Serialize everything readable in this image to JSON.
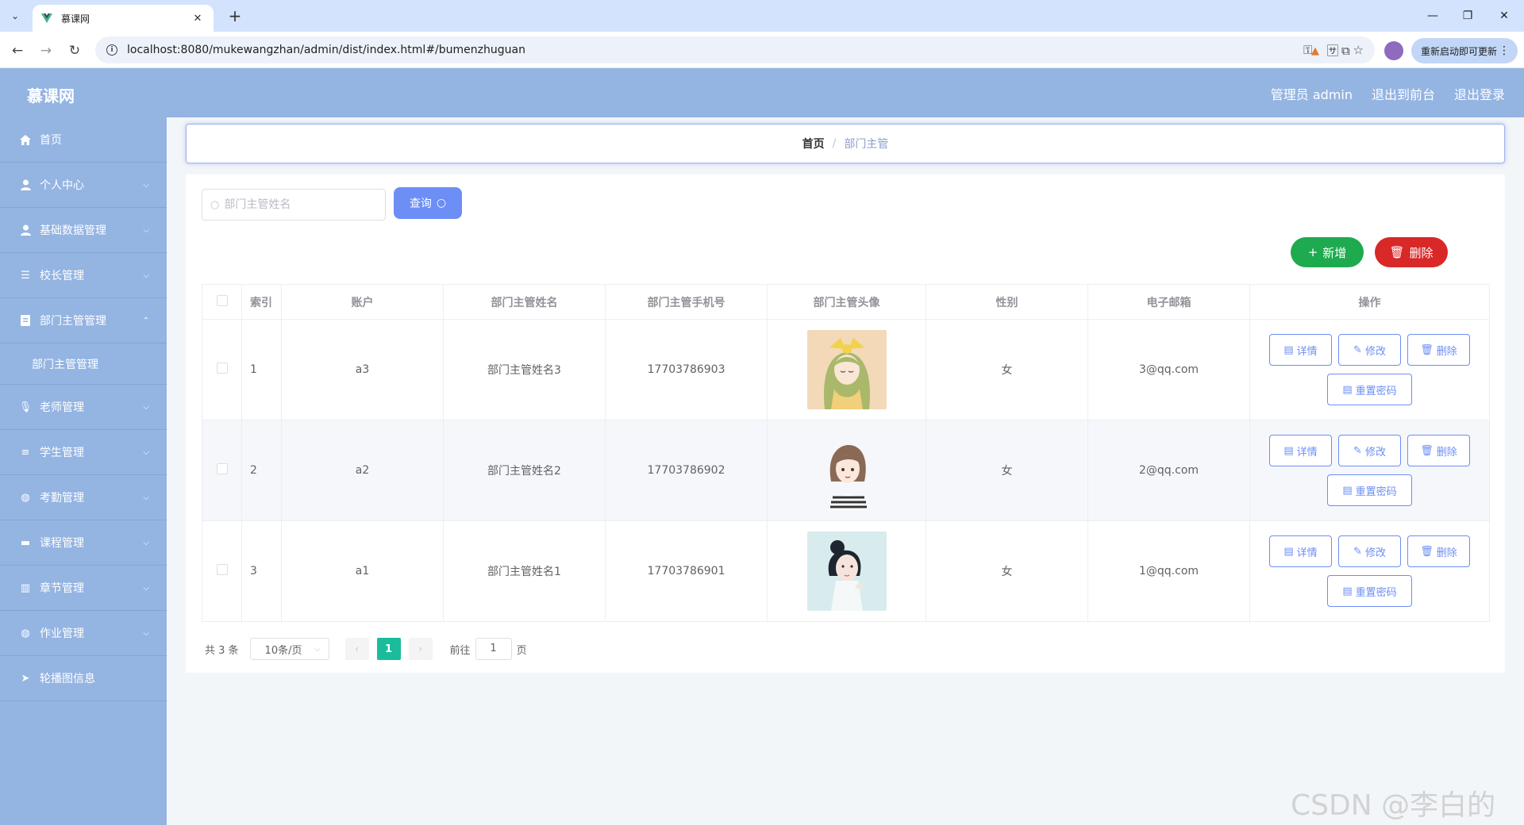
{
  "browser": {
    "tab_title": "慕课网",
    "url": "localhost:8080/mukewangzhan/admin/dist/index.html#/bumenzhuguan",
    "update_label": "重新启动即可更新"
  },
  "header": {
    "logo": "慕课网",
    "links": [
      "管理员 admin",
      "退出到前台",
      "退出登录"
    ]
  },
  "sidebar": {
    "items": [
      {
        "label": "首页",
        "icon": "home-icon"
      },
      {
        "label": "个人中心",
        "icon": "user-icon"
      },
      {
        "label": "基础数据管理",
        "icon": "user-icon"
      },
      {
        "label": "校长管理",
        "icon": "sliders-icon"
      },
      {
        "label": "部门主管管理",
        "icon": "document-icon"
      },
      {
        "label": "部门主管管理",
        "icon": "",
        "sub": true
      },
      {
        "label": "老师管理",
        "icon": "microphone-icon"
      },
      {
        "label": "学生管理",
        "icon": "list-icon"
      },
      {
        "label": "考勤管理",
        "icon": "globe-icon"
      },
      {
        "label": "课程管理",
        "icon": "chat-icon"
      },
      {
        "label": "章节管理",
        "icon": "chart-icon"
      },
      {
        "label": "作业管理",
        "icon": "globe-icon"
      },
      {
        "label": "轮播图信息",
        "icon": "send-icon"
      }
    ]
  },
  "breadcrumb": {
    "home": "首页",
    "separator": "/",
    "current": "部门主管"
  },
  "toolbar": {
    "search_placeholder": "部门主管姓名",
    "query_label": "查询",
    "add_label": "新增",
    "delete_label": "删除"
  },
  "table": {
    "columns": [
      "索引",
      "账户",
      "部门主管姓名",
      "部门主管手机号",
      "部门主管头像",
      "性别",
      "电子邮箱",
      "操作"
    ],
    "rows": [
      {
        "index": "1",
        "account": "a3",
        "name": "部门主管姓名3",
        "phone": "17703786903",
        "avatar": "avatar-cartoon-girl-bow",
        "gender": "女",
        "email": "3@qq.com"
      },
      {
        "index": "2",
        "account": "a2",
        "name": "部门主管姓名2",
        "phone": "17703786902",
        "avatar": "avatar-cartoon-girl-striped",
        "gender": "女",
        "email": "2@qq.com"
      },
      {
        "index": "3",
        "account": "a1",
        "name": "部门主管姓名1",
        "phone": "17703786901",
        "avatar": "avatar-photo-woman",
        "gender": "女",
        "email": "1@qq.com"
      }
    ],
    "actions": {
      "detail": "详情",
      "edit": "修改",
      "delete": "删除",
      "reset": "重置密码"
    }
  },
  "pagination": {
    "total": "共 3 条",
    "page_size": "10条/页",
    "current_page": "1",
    "goto_label": "前往",
    "goto_value": "1",
    "page_suffix": "页"
  },
  "watermark": "CSDN @李白的粉",
  "colors": {
    "header_bg": "#94b4e2",
    "primary": "#6c8ef5",
    "success": "#1eaa4f",
    "danger": "#d92828",
    "page_active": "#1abc9c"
  }
}
